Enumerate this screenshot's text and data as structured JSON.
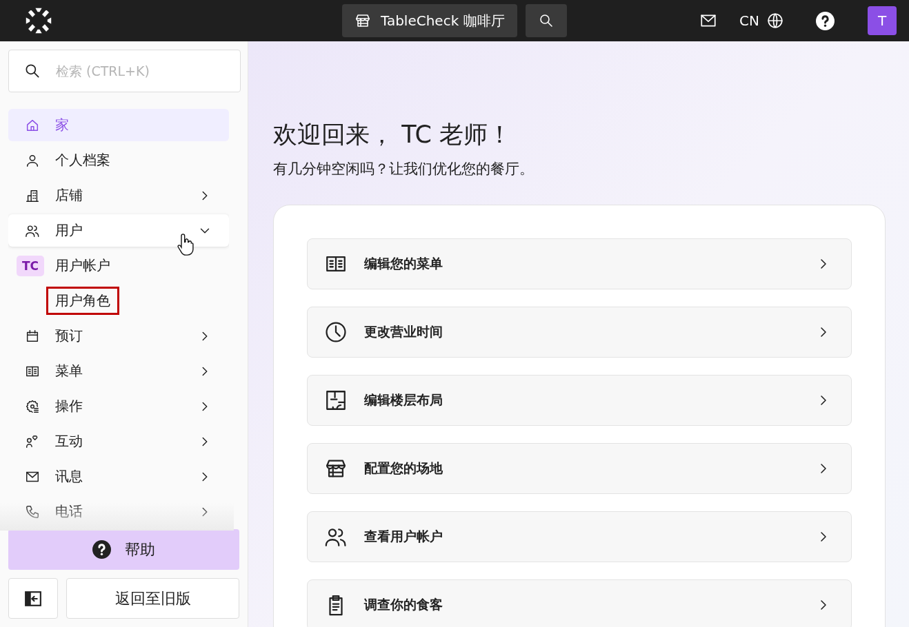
{
  "header": {
    "venue_button": "TableCheck 咖啡厅",
    "language": "CN",
    "avatar": "T"
  },
  "sidebar": {
    "search": {
      "placeholder": "检索 (CTRL+K)"
    },
    "items": [
      {
        "label": "家",
        "kind": "link",
        "selected": true
      },
      {
        "label": "个人档案",
        "kind": "link",
        "selected": false
      },
      {
        "label": "店铺",
        "kind": "group",
        "selected": false,
        "expanded": false
      },
      {
        "label": "用户",
        "kind": "group",
        "selected": false,
        "expanded": true,
        "children": [
          {
            "label": "用户帐户",
            "badge": "TC",
            "highlighted": false
          },
          {
            "label": "用户角色",
            "highlighted": true
          }
        ]
      },
      {
        "label": "预订",
        "kind": "group",
        "selected": false,
        "expanded": false
      },
      {
        "label": "菜单",
        "kind": "group",
        "selected": false,
        "expanded": false
      },
      {
        "label": "操作",
        "kind": "group",
        "selected": false,
        "expanded": false
      },
      {
        "label": "互动",
        "kind": "group",
        "selected": false,
        "expanded": false
      },
      {
        "label": "讯息",
        "kind": "group",
        "selected": false,
        "expanded": false
      },
      {
        "label": "电话",
        "kind": "group",
        "selected": false,
        "expanded": false
      }
    ],
    "help_button": "帮助",
    "legacy_button": "返回至旧版"
  },
  "main": {
    "greeting": "欢迎回来， TC 老师！",
    "subtitle": "有几分钟空闲吗？让我们优化您的餐厅。",
    "actions": [
      "编辑您的菜单",
      "更改营业时间",
      "编辑楼层布局",
      "配置您的场地",
      "查看用户帐户",
      "调查你的食客"
    ]
  }
}
